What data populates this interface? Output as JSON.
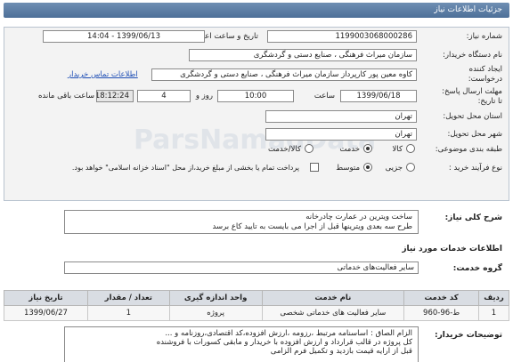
{
  "header": {
    "title": "جزئیات اطلاعات نیاز"
  },
  "form": {
    "need_number_label": "شماره نیاز:",
    "need_number": "1199003068000286",
    "announce_date_label": "تاریخ و ساعت اعلان عمومی:",
    "announce_date": "1399/06/13 - 14:04",
    "buyer_label": "نام دستگاه خریدار:",
    "buyer": "سازمان میراث فرهنگی ، صنایع دستی و گردشگری",
    "creator_label_1": "ایجاد کننده",
    "creator_label_2": "درخواست:",
    "creator": "کاوه معین پور کارپرداز سازمان میراث فرهنگی ، صنایع دستی و گردشگری",
    "contact_link": "اطلاعات تماس خریدار",
    "deadline_label_1": "مهلت ارسال پاسخ:",
    "deadline_label_2": "تا تاریخ:",
    "deadline_date": "1399/06/18",
    "time_label": "ساعت",
    "deadline_time": "10:00",
    "day_label": "روز و",
    "days_left": "4",
    "remaining_time": "18:12:24",
    "remaining_label": "ساعت باقی مانده",
    "province_label": "استان محل تحویل:",
    "province": "تهران",
    "city_label": "شهر محل تحویل:",
    "city": "تهران",
    "category_label": "طبقه بندی موضوعی:",
    "cat_goods": "کالا",
    "cat_service": "خدمت",
    "cat_goods_service": "کالا/خدمت",
    "process_label": "نوع فرآیند خرید :",
    "proc_partial": "جزیی",
    "proc_medium": "متوسط",
    "payment_note": "پرداخت تمام یا بخشی از مبلغ خرید،از محل \"اسناد خزانه اسلامی\" خواهد بود."
  },
  "description": {
    "label": "شرح کلی نیاز:",
    "line1": "ساخت ویترین در عمارت چادرخانه",
    "line2": "طرح سه بعدی ویترینها قبل از اجرا می بایست به تایید کاع برسد"
  },
  "services": {
    "section_title": "اطلاعات خدمات مورد نیاز",
    "group_label": "گروه خدمت:",
    "group_value": "سایر فعالیت‌های خدماتی"
  },
  "table": {
    "headers": [
      "ردیف",
      "کد خدمت",
      "نام خدمت",
      "واحد اندازه گیری",
      "تعداد / مقدار",
      "تاریخ نیاز"
    ],
    "rows": [
      [
        "1",
        "ط-96-960",
        "سایر فعالیت های خدماتی شخصی",
        "پروژه",
        "1",
        "1399/06/27"
      ]
    ]
  },
  "notes": {
    "label": "توضیحات خریدار:",
    "line1": "الزام الصاق : اساسنامه مرتبط ،رزومه ،ارزش افزوده،کد اقتصادی،روزنامه و ...",
    "line2": "کل پروژه در قالب قرارداد و ارزش افزوده با خریدار و مابقی کسورات با فروشنده",
    "line3": "قبل از ارایه قیمت بازدید و تکمیل فرم الزامی"
  }
}
